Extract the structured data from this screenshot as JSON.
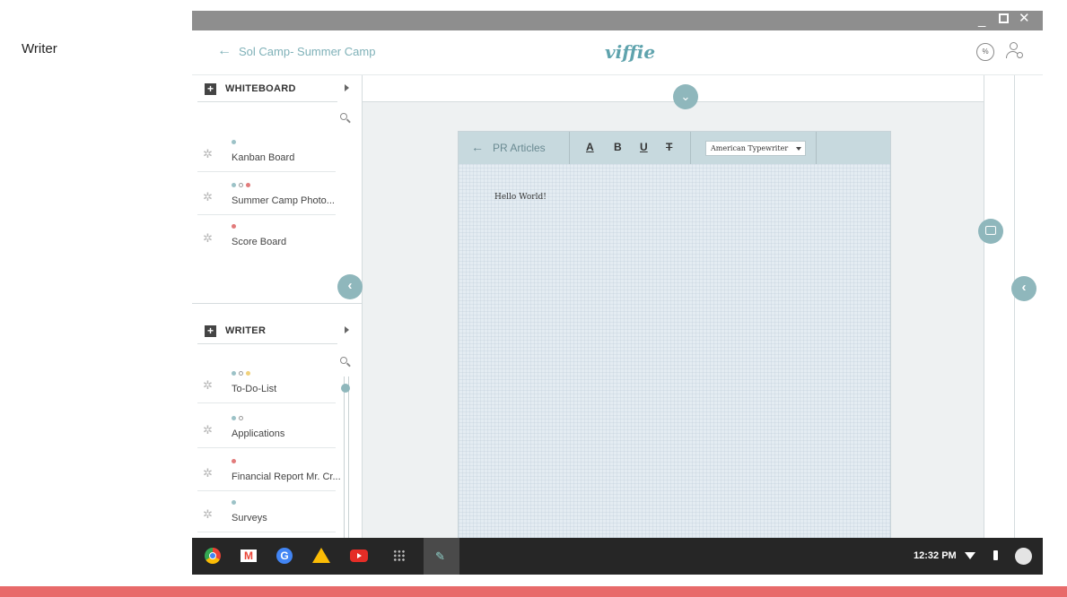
{
  "caption": "Writer",
  "window": {
    "controls": {
      "minimize": "_",
      "close": "✕"
    }
  },
  "appbar": {
    "back_icon": "←",
    "breadcrumb": "Sol Camp- Summer Camp",
    "brand": "viffie",
    "badge_text": "%"
  },
  "sidebar": {
    "whiteboard": {
      "plus": "+",
      "title": "WHITEBOARD",
      "items": [
        {
          "label": "Kanban Board",
          "dots": [
            "teal"
          ]
        },
        {
          "label": "Summer Camp Photo...",
          "dots": [
            "teal",
            "ring",
            "red"
          ]
        },
        {
          "label": "Score Board",
          "dots": [
            "red"
          ]
        }
      ]
    },
    "writer": {
      "plus": "+",
      "title": "WRITER",
      "items": [
        {
          "label": "To-Do-List",
          "dots": [
            "teal",
            "ring",
            "yellow"
          ]
        },
        {
          "label": "Applications",
          "dots": [
            "teal",
            "ring"
          ]
        },
        {
          "label": "Financial Report Mr. Cr...",
          "dots": [
            "red"
          ]
        },
        {
          "label": "Surveys",
          "dots": [
            "teal"
          ]
        }
      ]
    },
    "collapse_icon": "‹"
  },
  "document": {
    "back_icon": "←",
    "title": "PR Articles",
    "format": {
      "font_color": "A",
      "bold": "B",
      "underline": "U",
      "strike": "T"
    },
    "font_select": "American Typewriter",
    "body": "Hello World!"
  },
  "main": {
    "drop_icon": "⌄"
  },
  "right_panel": {
    "side_icon": "‹"
  },
  "shelf": {
    "google_letter": "G",
    "gmail_letter": "M",
    "time": "12:32 PM"
  },
  "colors": {
    "accent": "#8fb7bc",
    "brand": "#5fa3ad",
    "toolbar": "#c7d9de",
    "footer_bar": "#e86a6a"
  }
}
